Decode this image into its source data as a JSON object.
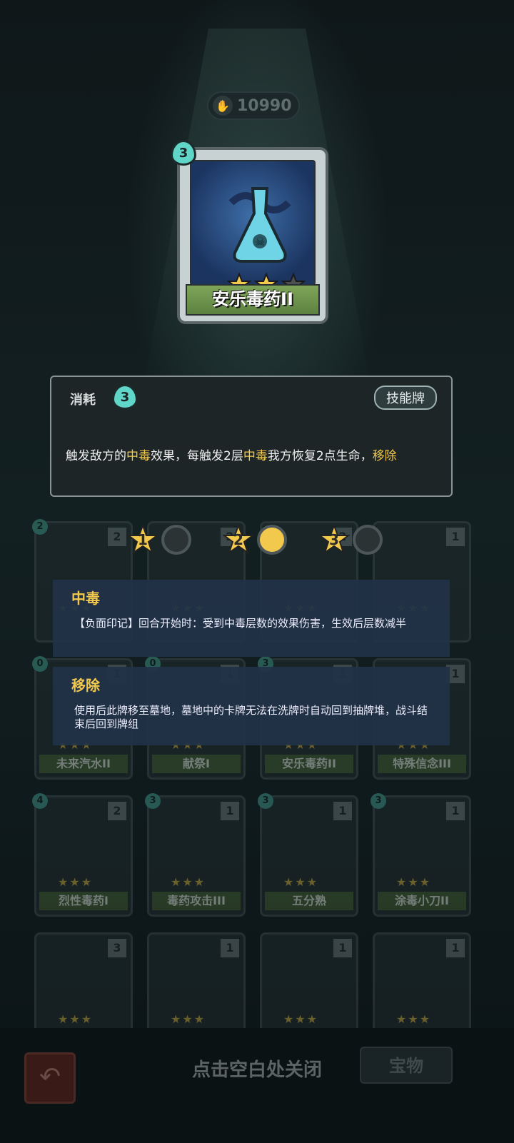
{
  "currency": {
    "value": "10990",
    "icon": "skull-hand-icon"
  },
  "featured_card": {
    "cost": "3",
    "name": "安乐毒药II",
    "stars_filled": 2,
    "stars_total": 3
  },
  "description": {
    "cost_label": "消耗",
    "cost_value": "3",
    "type_label": "技能牌",
    "text_parts": [
      "触发敌方的",
      "中毒",
      "效果，每触发2层",
      "中毒",
      "我方恢复2点生命，",
      "移除"
    ]
  },
  "upgrade_levels": [
    {
      "level": "1",
      "filled": false
    },
    {
      "level": "2",
      "filled": true
    },
    {
      "level": "3",
      "filled": false
    }
  ],
  "keywords": [
    {
      "title": "中毒",
      "body": "【负面印记】回合开始时：受到中毒层数的效果伤害，生效后层数减半"
    },
    {
      "title": "移除",
      "body": "使用后此牌移至墓地，墓地中的卡牌无法在洗牌时自动回到抽牌堆，战斗结束后回到牌组"
    }
  ],
  "deck_cards": [
    {
      "name": "",
      "cost": "2",
      "count": "2"
    },
    {
      "name": "",
      "cost": "",
      "count": "2"
    },
    {
      "name": "",
      "cost": "",
      "count": "2"
    },
    {
      "name": "",
      "cost": "",
      "count": "1"
    },
    {
      "name": "未来汽水II",
      "cost": "0",
      "count": "1"
    },
    {
      "name": "献祭I",
      "cost": "0",
      "count": "1"
    },
    {
      "name": "安乐毒药II",
      "cost": "3",
      "count": "1"
    },
    {
      "name": "特殊信念III",
      "cost": "",
      "count": "1"
    },
    {
      "name": "烈性毒药I",
      "cost": "4",
      "count": "2"
    },
    {
      "name": "毒药攻击III",
      "cost": "3",
      "count": "1"
    },
    {
      "name": "五分熟",
      "cost": "3",
      "count": "1"
    },
    {
      "name": "涂毒小刀II",
      "cost": "3",
      "count": "1"
    },
    {
      "name": "",
      "cost": "",
      "count": "3"
    },
    {
      "name": "",
      "cost": "",
      "count": "1"
    },
    {
      "name": "",
      "cost": "",
      "count": "1"
    },
    {
      "name": "",
      "cost": "",
      "count": "1"
    }
  ],
  "bottom": {
    "close_hint": "点击空白处关闭",
    "tab_right": "宝物",
    "back_icon": "back-arrow-icon"
  }
}
